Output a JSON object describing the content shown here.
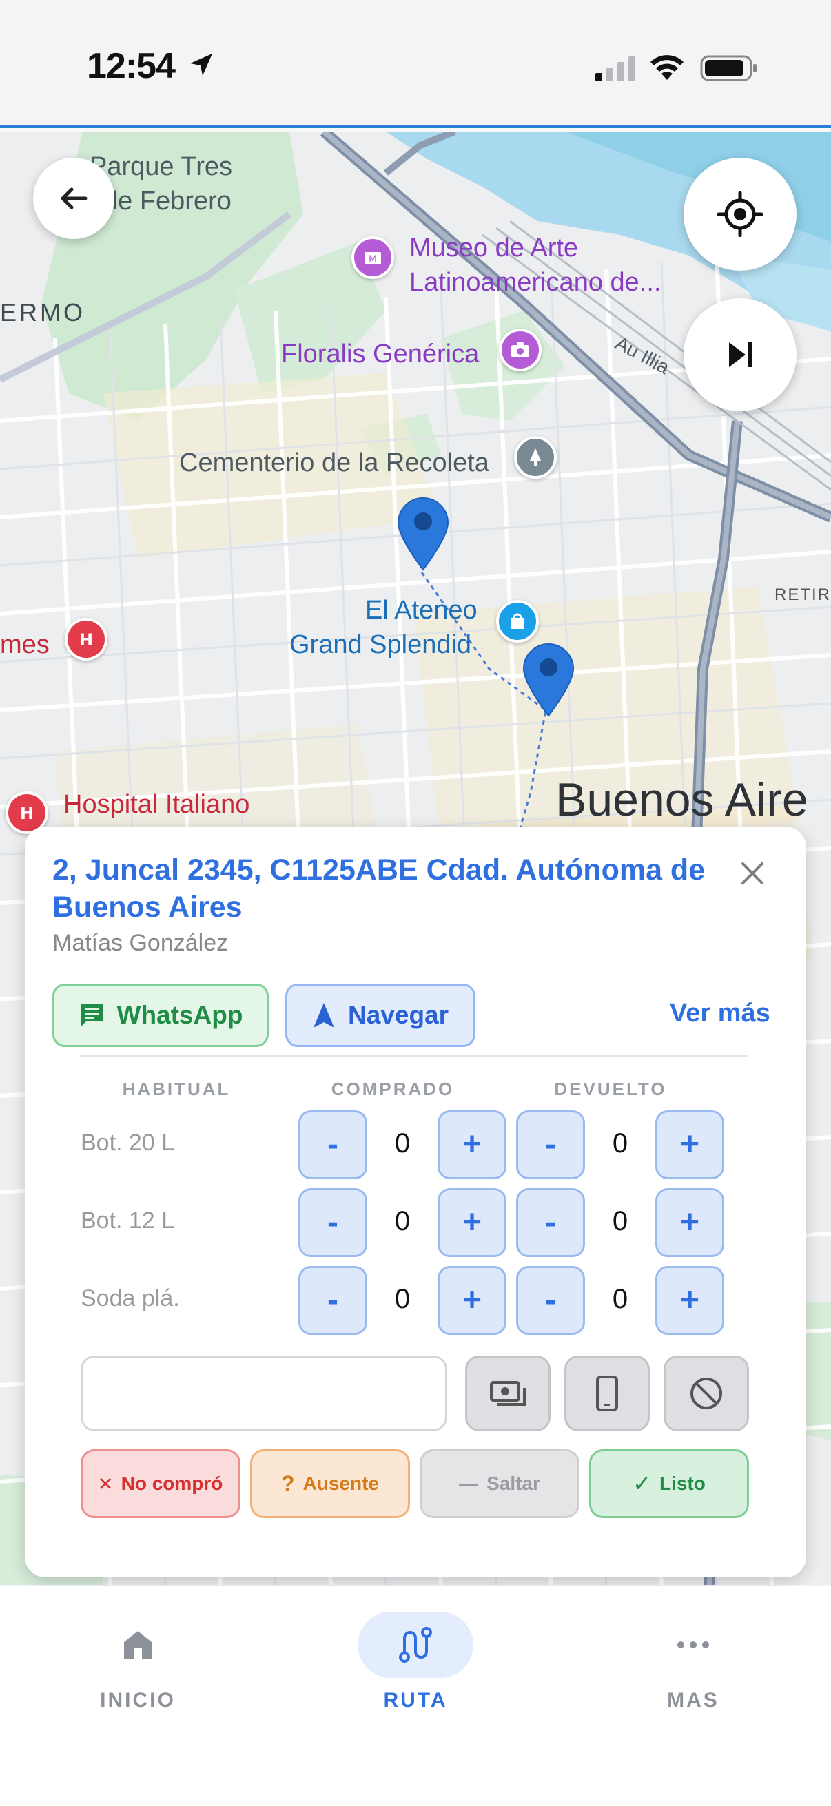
{
  "status_bar": {
    "time": "12:54"
  },
  "map": {
    "labels": {
      "parque": "Parque Tres",
      "febrero": "de Febrero",
      "museo_1": "Museo de Arte",
      "museo_2": "Latinoamericano de...",
      "ermo": "ERMO",
      "floralis": "Floralis Genérica",
      "cementerio": "Cementerio de la Recoleta",
      "ateneo_1": "El Ateneo",
      "ateneo_2": "Grand Splendid",
      "mes": "mes",
      "hospital": "Hospital Italiano",
      "buenos_aires": "Buenos Aire",
      "retir": "RETIR",
      "autopista": "Au Illia"
    }
  },
  "card": {
    "address": "2, Juncal 2345, C1125ABE Cdad. Autónoma de Buenos Aires",
    "client": "Matías González",
    "whatsapp_label": "WhatsApp",
    "navegar_label": "Navegar",
    "ver_mas_label": "Ver más",
    "columns": {
      "habitual": "HABITUAL",
      "comprado": "COMPRADO",
      "devuelto": "DEVUELTO"
    },
    "minus": "-",
    "plus": "+",
    "products": [
      {
        "name": "Bot. 20 L",
        "comprado": "0",
        "devuelto": "0"
      },
      {
        "name": "Bot. 12 L",
        "comprado": "0",
        "devuelto": "0"
      },
      {
        "name": "Soda plá.",
        "comprado": "0",
        "devuelto": "0"
      }
    ],
    "observation_value": "",
    "actions": {
      "no_compro": "No compró",
      "ausente": "Ausente",
      "saltar": "Saltar",
      "listo": "Listo"
    },
    "action_icons": {
      "no_compro": "×",
      "ausente": "?",
      "saltar": "—",
      "listo": "✓"
    }
  },
  "bottom_nav": {
    "items": [
      {
        "label": "INICIO",
        "icon": "home-icon",
        "active": false
      },
      {
        "label": "RUTA",
        "icon": "route-icon",
        "active": true
      },
      {
        "label": "MAS",
        "icon": "more-icon",
        "active": false
      }
    ]
  },
  "colors": {
    "accent": "#2f6fe0",
    "whatsapp": "#1f8d46",
    "danger": "#d62f2f",
    "warning": "#d67a18",
    "success": "#1f8d46"
  }
}
